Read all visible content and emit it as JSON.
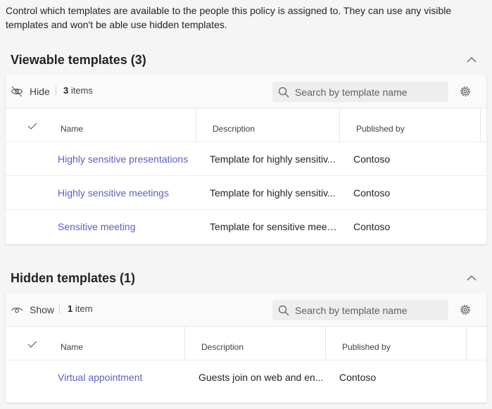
{
  "intro": "Control which templates are available to the people this policy is assigned to. They can use any visible templates and won't be able use hidden templates.",
  "viewable": {
    "title": "Viewable templates (3)",
    "toggle_label": "Hide",
    "count_number": "3",
    "count_suffix": "items",
    "search_placeholder": "Search by template name",
    "columns": {
      "name": "Name",
      "description": "Description",
      "published_by": "Published by"
    },
    "rows": [
      {
        "name": "Highly sensitive presentations",
        "description": "Template for highly sensitiv...",
        "published_by": "Contoso"
      },
      {
        "name": "Highly sensitive meetings",
        "description": "Template for highly sensitiv...",
        "published_by": "Contoso"
      },
      {
        "name": "Sensitive meeting",
        "description": "Template for sensitive meet...",
        "published_by": "Contoso"
      }
    ]
  },
  "hidden": {
    "title": "Hidden templates (1)",
    "toggle_label": "Show",
    "count_number": "1",
    "count_suffix": "item",
    "search_placeholder": "Search by template name",
    "columns": {
      "name": "Name",
      "description": "Description",
      "published_by": "Published by"
    },
    "rows": [
      {
        "name": "Virtual appointment",
        "description": "Guests join on web and en...",
        "published_by": "Contoso"
      }
    ]
  },
  "colors": {
    "link": "#5b5fc7",
    "background": "#f5f5f5"
  },
  "icons": [
    "eye-off-icon",
    "eye-icon",
    "search-icon",
    "gear-icon",
    "chevron-up-icon",
    "checkmark-icon"
  ]
}
